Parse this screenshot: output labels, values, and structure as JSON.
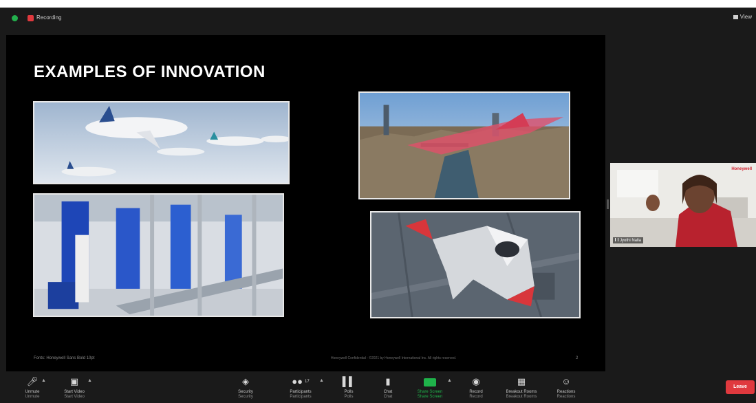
{
  "top_bar": {
    "recording_label": "Recording",
    "view_label": "View"
  },
  "slide": {
    "title": "EXAMPLES OF INNOVATION",
    "footer": "Fonts: Honeywell Sans Bold 10pt",
    "copyright": "Honeywell Confidential - ©2021 by Honeywell International Inc. All rights reserved.",
    "page_number": "2",
    "images": [
      {
        "icon": "aircraft-fleet-photo"
      },
      {
        "icon": "city-air-vehicle-photo"
      },
      {
        "icon": "industrial-plant-photo"
      },
      {
        "icon": "air-taxi-render-photo"
      }
    ]
  },
  "video": {
    "participant_name": "Jyothi Nalla",
    "brand_label": "Honeywell"
  },
  "toolbar": {
    "unmute": {
      "label": "Unmute",
      "label_shadow": "Unmute"
    },
    "start_video": {
      "label": "Start Video",
      "label_shadow": "Start Video"
    },
    "security": {
      "label": "Security",
      "label_shadow": "Security"
    },
    "participants": {
      "label": "Participants",
      "label_shadow": "Participants",
      "count": "17"
    },
    "polls": {
      "label": "Polls",
      "label_shadow": "Polls"
    },
    "chat": {
      "label": "Chat",
      "label_shadow": "Chat"
    },
    "share_screen": {
      "label": "Share Screen",
      "label_shadow": "Share Screen"
    },
    "record": {
      "label": "Record",
      "label_shadow": "Record"
    },
    "breakout_rooms": {
      "label": "Breakout Rooms",
      "label_shadow": "Breakout Rooms"
    },
    "reactions": {
      "label": "Reactions",
      "label_shadow": "Reactions"
    },
    "leave": {
      "label": "Leave"
    }
  },
  "colors": {
    "recording_red": "#e0393e",
    "share_green": "#1fb24a",
    "leave_red": "#e0393e",
    "security_green": "#23b04d"
  }
}
